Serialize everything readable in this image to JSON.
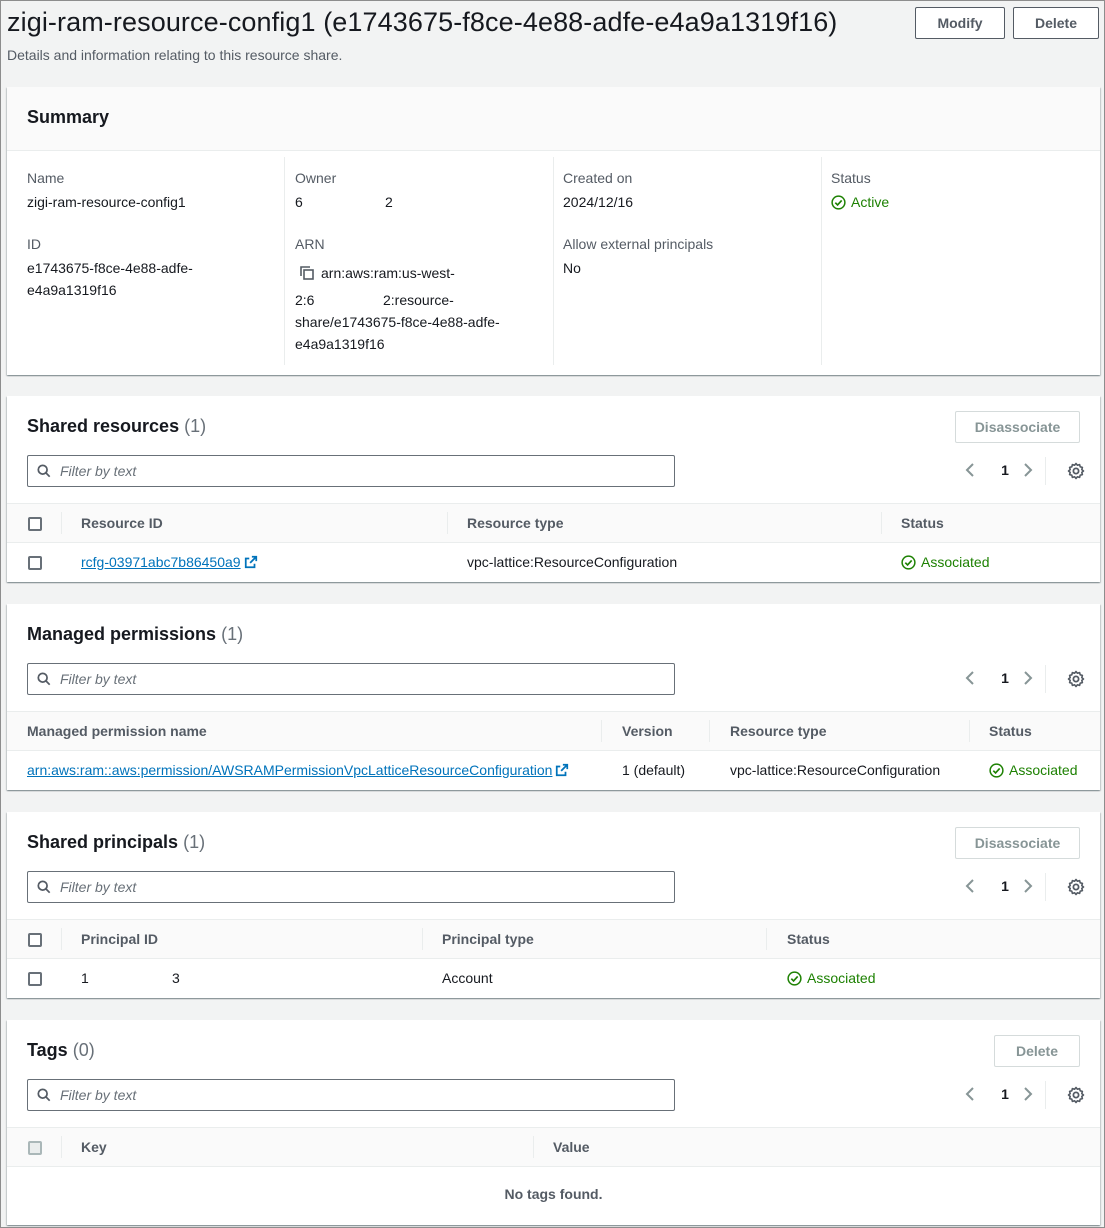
{
  "page": {
    "title": "zigi-ram-resource-config1 (e1743675-f8ce-4e88-adfe-e4a9a1319f16)",
    "description": "Details and information relating to this resource share.",
    "modify_label": "Modify",
    "delete_label": "Delete"
  },
  "summary": {
    "title": "Summary",
    "name_label": "Name",
    "name_value": "zigi-ram-resource-config1",
    "id_label": "ID",
    "id_value_1": "e1743675-f8ce-4e88-adfe-",
    "id_value_2": "e4a9a1319f16",
    "owner_label": "Owner",
    "owner_value_a": "6",
    "owner_value_b": "2",
    "arn_label": "ARN",
    "arn_line_1": "arn:aws:ram:us-west-",
    "arn_line_2a": "2:6",
    "arn_line_2b": "2:resource-",
    "arn_line_3": "share/e1743675-f8ce-4e88-adfe-",
    "arn_line_4": "e4a9a1319f16",
    "created_label": "Created on",
    "created_value": "2024/12/16",
    "external_label": "Allow external principals",
    "external_value": "No",
    "status_label": "Status",
    "status_value": "Active"
  },
  "shared_resources": {
    "title": "Shared resources",
    "count": "(1)",
    "disassociate_label": "Disassociate",
    "filter_placeholder": "Filter by text",
    "page": "1",
    "columns": [
      "Resource ID",
      "Resource type",
      "Status"
    ],
    "rows": [
      {
        "id": "rcfg-03971abc7b86450a9",
        "type": "vpc-lattice:ResourceConfiguration",
        "status": "Associated"
      }
    ]
  },
  "managed_permissions": {
    "title": "Managed permissions",
    "count": "(1)",
    "filter_placeholder": "Filter by text",
    "page": "1",
    "columns": [
      "Managed permission name",
      "Version",
      "Resource type",
      "Status"
    ],
    "rows": [
      {
        "name": "arn:aws:ram::aws:permission/AWSRAMPermissionVpcLatticeResourceConfiguration",
        "version": "1 (default)",
        "type": "vpc-lattice:ResourceConfiguration",
        "status": "Associated"
      }
    ]
  },
  "shared_principals": {
    "title": "Shared principals",
    "count": "(1)",
    "disassociate_label": "Disassociate",
    "filter_placeholder": "Filter by text",
    "page": "1",
    "columns": [
      "Principal ID",
      "Principal type",
      "Status"
    ],
    "rows": [
      {
        "id_a": "1",
        "id_b": "3",
        "type": "Account",
        "status": "Associated"
      }
    ]
  },
  "tags": {
    "title": "Tags",
    "count": "(0)",
    "delete_label": "Delete",
    "filter_placeholder": "Filter by text",
    "page": "1",
    "columns": [
      "Key",
      "Value"
    ],
    "empty_text": "No tags found."
  },
  "colors": {
    "link": "#0073bb",
    "success": "#1d8102",
    "text": "#16191f",
    "muted": "#545b64"
  }
}
